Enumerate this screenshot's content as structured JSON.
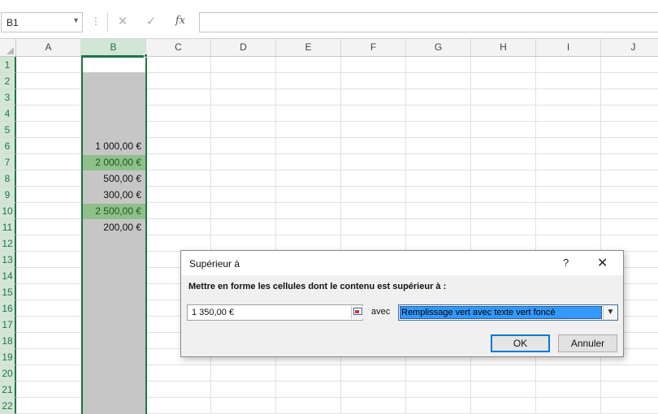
{
  "formula_bar": {
    "name_box": "B1",
    "separator": "⋮",
    "cancel_icon": "✕",
    "enter_icon": "✓",
    "fx_label": "fx",
    "formula_value": ""
  },
  "columns": [
    "A",
    "B",
    "C",
    "D",
    "E",
    "F",
    "G",
    "H",
    "I",
    "J"
  ],
  "selected_column": "B",
  "rows": [
    "1",
    "2",
    "3",
    "4",
    "5",
    "6",
    "7",
    "8",
    "9",
    "10",
    "11",
    "12",
    "13",
    "14",
    "15",
    "16",
    "17",
    "18",
    "19",
    "20",
    "21",
    "22"
  ],
  "cells": [
    {
      "row": "6",
      "value": "1 000,00 €",
      "highlight": false
    },
    {
      "row": "7",
      "value": "2 000,00 €",
      "highlight": true
    },
    {
      "row": "8",
      "value": "500,00 €",
      "highlight": false
    },
    {
      "row": "9",
      "value": "300,00 €",
      "highlight": false
    },
    {
      "row": "10",
      "value": "2 500,00 €",
      "highlight": true
    },
    {
      "row": "11",
      "value": "200,00 €",
      "highlight": false
    }
  ],
  "colors": {
    "selection_green": "#217346",
    "header_selected_bg": "#d2e6d6",
    "column_fill_gray": "#c6c6c6",
    "highlight_fill": "#8fbf8a",
    "highlight_text": "#1e5a1e"
  },
  "dialog": {
    "title": "Supérieur à",
    "help": "?",
    "close": "✕",
    "prompt": "Mettre en forme les cellules dont le contenu est supérieur à :",
    "value": "1 350,00 €",
    "with_label": "avec",
    "format_value": "Remplissage vert avec texte vert foncé",
    "ok_label": "OK",
    "cancel_label": "Annuler",
    "collapse_icon": "collapse-dialog-icon",
    "dropdown_icon": "chevron-down-icon"
  }
}
